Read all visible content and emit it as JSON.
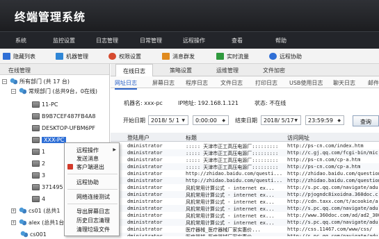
{
  "app": {
    "title": "终端管理系统"
  },
  "menu": [
    "系统",
    "监控设置",
    "日志管理",
    "日常管理",
    "远程操作",
    "查看",
    "帮助"
  ],
  "toolbar": [
    {
      "label": "隐藏列表",
      "icon": "list-icon",
      "color": "#2f6fd6"
    },
    {
      "label": "机器管理",
      "icon": "computer-icon",
      "color": "#2f86d6"
    },
    {
      "label": "权限设置",
      "icon": "shield-icon",
      "color": "#d64a2f"
    },
    {
      "label": "消息群发",
      "icon": "message-icon",
      "color": "#e08a1e"
    },
    {
      "label": "实时流量",
      "icon": "chart-icon",
      "color": "#2f9a3e"
    },
    {
      "label": "远程协助",
      "icon": "remote-icon",
      "color": "#2f6fd6"
    }
  ],
  "left": {
    "header": "在线管理",
    "tree": [
      {
        "label": "所有部门 (共 17 台)",
        "icon": "group-icon"
      },
      {
        "label": "常规部门 (总共9台，0在线)",
        "icon": "group-icon"
      },
      {
        "label": "11-PC",
        "icon": "computer-icon"
      },
      {
        "label": "B9B7CEF487FB4A8",
        "icon": "computer-icon"
      },
      {
        "label": "DESKTOP-UFBM6PF",
        "icon": "computer-icon"
      },
      {
        "label": "XXX-PC",
        "icon": "computer-icon"
      },
      {
        "label": "1",
        "icon": "computer-icon"
      },
      {
        "label": "2",
        "icon": "computer-icon"
      },
      {
        "label": "3",
        "icon": "computer-icon"
      },
      {
        "label": "371495",
        "icon": "computer-icon"
      },
      {
        "label": "4",
        "icon": "computer-icon"
      },
      {
        "label": "cs01 (总共1",
        "icon": "group-icon"
      },
      {
        "label": "alex (总共1台",
        "icon": "group-icon"
      },
      {
        "label": "cs001",
        "icon": "group-icon"
      }
    ]
  },
  "tabs": [
    "在线日志",
    "策略设置",
    "运维管理",
    "文件加密"
  ],
  "subtabs": [
    "网址日志",
    "屏幕日志",
    "程序日志",
    "文件日志",
    "打印日志",
    "USB使用日志",
    "聊天日志",
    "邮件"
  ],
  "info": {
    "machine_label": "机器名: xxx-pc",
    "ip_label": "IP地址: 192.168.1.121",
    "status_label": "状态: 不在线"
  },
  "filter": {
    "start_label": "开始日期",
    "start_date": "2018/ 5/ 1",
    "start_time": "0:00:00",
    "end_label": "结束日期",
    "end_date": "2018/ 5/17",
    "end_time": "23:59:59",
    "query_button": "查询"
  },
  "table": {
    "columns": [
      "登陆用户",
      "标题",
      "访问网址"
    ],
    "rows": [
      [
        "dministrator",
        "::::: 天津市正工高压电源厂:::::::::",
        "http://ps-cn.com/index.htm"
      ],
      [
        "dministrator",
        "::::: 天津市正工高压电源厂:::::::::",
        "http://c.gj.qq.com/fcgi-bin/mic"
      ],
      [
        "dministrator",
        "::::: 天津市正工高压电源厂:::::::::",
        "http://ps-cn.com/cp-a.htm"
      ],
      [
        "dministrator",
        "::::: 天津市正工高压电源厂:::::::::",
        "http://ps-cn.com/cp-a.htm"
      ],
      [
        "dministrator",
        "http://zhidao.baidu.com/questi...",
        "http://zhidao.baidu.com/question"
      ],
      [
        "dministrator",
        "http://zhidao.baidu.com/questi...",
        "http://zhidao.baidu.com/question"
      ],
      [
        "dministrator",
        "风机常用计算公式 - internet ex...",
        "http://s.pc.qq.com/navigate/adu"
      ],
      [
        "dministrator",
        "风机常用计算公式 - internet ex...",
        "http://pjogndc8ixoidna.360doc.c"
      ],
      [
        "dministrator",
        "风机常用计算公式 - internet ex...",
        "http://cdn.taxx.com/t/acookie/a"
      ],
      [
        "dministrator",
        "风机常用计算公式 - internet ex...",
        "http://s.pc.qq.com/navigate/adu"
      ],
      [
        "dministrator",
        "风机常用计算公式 - internet ex...",
        "http://www.360doc.com/ad/ad2_300"
      ],
      [
        "dministrator",
        "风机常用计算公式 - internet ex...",
        "http://s.pc.qq.com/navigate/adu"
      ],
      [
        "dministrator",
        "医疗器械_医疗器械厂家实惠价...",
        "http://css.11467.com/www/css/"
      ],
      [
        "dministrator",
        "医疗器械_医疗器械厂家实惠价...",
        "http://s.pc.qq.com/navigate/adu"
      ]
    ]
  },
  "context_menu": [
    {
      "label": "远程操作",
      "submenu": true
    },
    {
      "label": "发送消息"
    },
    {
      "label": "客户端退出",
      "icon": "exit-icon"
    },
    {
      "label": "远程协助"
    },
    {
      "label": "网络连接测试"
    },
    {
      "label": "导出屏幕日志"
    },
    {
      "label": "历史日志清理"
    },
    {
      "label": "清理垃圾文件"
    }
  ]
}
